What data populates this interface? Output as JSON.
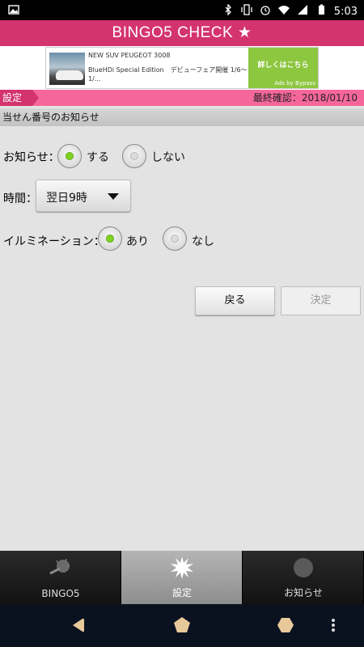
{
  "status_bar": {
    "time": "5:03"
  },
  "app": {
    "title": "BINGO5 CHECK ★"
  },
  "ad": {
    "title": "NEW SUV PEUGEOT 3008",
    "body": "BlueHDi Special Edition　デビューフェア開催 1/6〜1/...",
    "cta": "詳しくはこちら",
    "by": "Ads by Bypass"
  },
  "header": {
    "tag": "設定",
    "last_check": "最終確認：2018/01/10"
  },
  "section": {
    "title": "当せん番号のお知らせ"
  },
  "notify": {
    "label": "お知らせ：",
    "options": [
      "する",
      "しない"
    ],
    "selected": "する"
  },
  "time": {
    "label": "時間：",
    "value": "翌日9時"
  },
  "illumination": {
    "label": "イルミネーション：",
    "options": [
      "あり",
      "なし"
    ],
    "selected": "あり"
  },
  "buttons": {
    "back": "戻る",
    "decide": "決定"
  },
  "tabs": [
    {
      "label": "BINGO5",
      "icon": "bingo-ball-icon"
    },
    {
      "label": "設定",
      "icon": "settings-burst-icon"
    },
    {
      "label": "お知らせ",
      "icon": "notice-circle-icon"
    }
  ],
  "active_tab": "設定",
  "colors": {
    "title_bar": "#d4346d",
    "pink_bar": "#f5679b",
    "ad_cta": "#8dc63f",
    "radio_on": "#7ed321"
  }
}
